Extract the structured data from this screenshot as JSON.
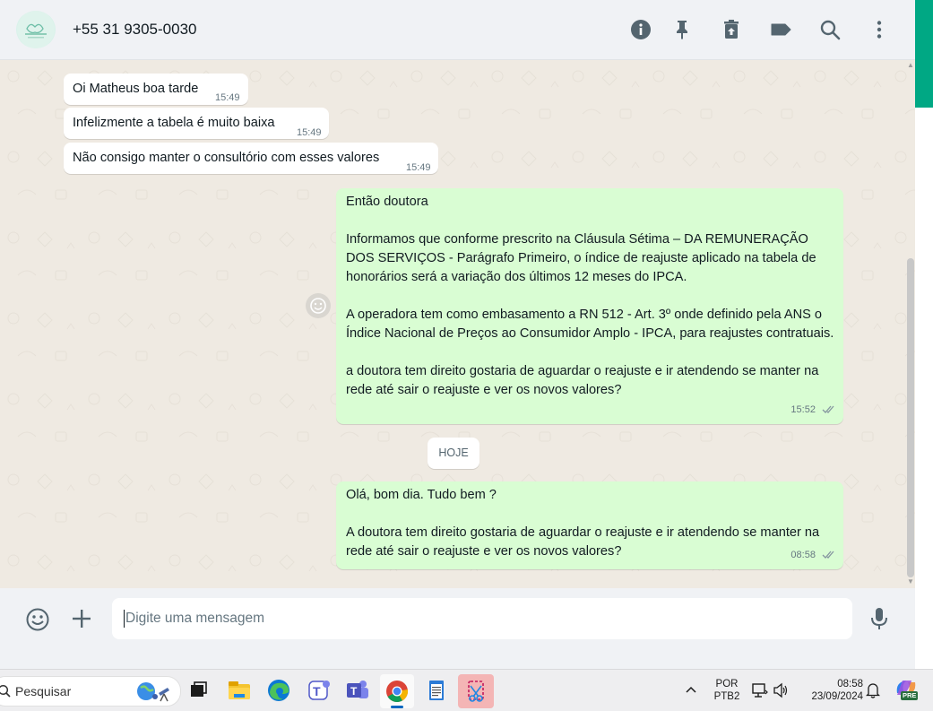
{
  "header": {
    "contact": "+55 31 9305-0030",
    "icons": [
      "info-icon",
      "pin-icon",
      "trash-icon",
      "label-icon",
      "search-icon",
      "kebab-menu-icon"
    ]
  },
  "messages": [
    {
      "dir": "in",
      "text": "Oi Matheus boa tarde",
      "time": "15:49"
    },
    {
      "dir": "in",
      "text": "Infelizmente a tabela é muito baixa",
      "time": "15:49"
    },
    {
      "dir": "in",
      "text": "Não consigo manter o consultório com esses valores",
      "time": "15:49"
    },
    {
      "dir": "out",
      "text": "Então doutora\n\nInformamos que conforme prescrito na Cláusula Sétima – DA REMUNERAÇÃO DOS SERVIÇOS - Parágrafo Primeiro, o índice de reajuste aplicado na tabela de honorários será a variação dos últimos 12 meses do IPCA.\n\nA operadora tem como embasamento a RN 512 - Art. 3º onde definido pela ANS o Índice Nacional de Preços ao Consumidor Amplo - IPCA, para reajustes contratuais.\n\na doutora tem direito gostaria de aguardar o reajuste e ir atendendo se manter na rede até sair o reajuste e ver os novos valores?",
      "time": "15:52"
    },
    {
      "dir": "out",
      "text": "Olá, bom dia. Tudo bem ?\n\nA doutora tem direito gostaria de aguardar o reajuste e ir atendendo se manter na rede até sair o reajuste e ver os novos valores?",
      "time": "08:58"
    }
  ],
  "date_chip": "HOJE",
  "composer": {
    "placeholder": "Digite uma mensagem",
    "icons": [
      "emoji-icon",
      "plus-icon",
      "microphone-icon"
    ]
  },
  "taskbar": {
    "search_label": "Pesquisar",
    "lang_top": "POR",
    "lang_bottom": "PTB2",
    "time": "08:58",
    "date": "23/09/2024",
    "badge": "PRE"
  },
  "colors": {
    "outgoing_bubble": "#d9fdd3",
    "incoming_bubble": "#ffffff",
    "chat_bg": "#efeae2",
    "accent": "#00a884",
    "check_marks": "#8696a0"
  }
}
